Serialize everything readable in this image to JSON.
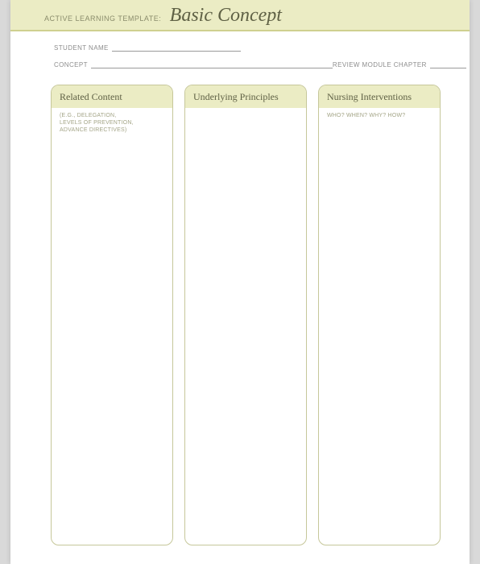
{
  "header": {
    "prefix": "ACTIVE LEARNING TEMPLATE:",
    "title": "Basic Concept"
  },
  "meta": {
    "student_label": "STUDENT NAME",
    "concept_label": "CONCEPT",
    "chapter_label": "REVIEW MODULE CHAPTER"
  },
  "columns": [
    {
      "heading": "Related Content",
      "sub": "(E.G., DELEGATION,\nLEVELS OF PREVENTION,\nADVANCE DIRECTIVES)"
    },
    {
      "heading": "Underlying Principles",
      "sub": ""
    },
    {
      "heading": "Nursing Interventions",
      "sub": "WHO? WHEN? WHY? HOW?"
    }
  ]
}
